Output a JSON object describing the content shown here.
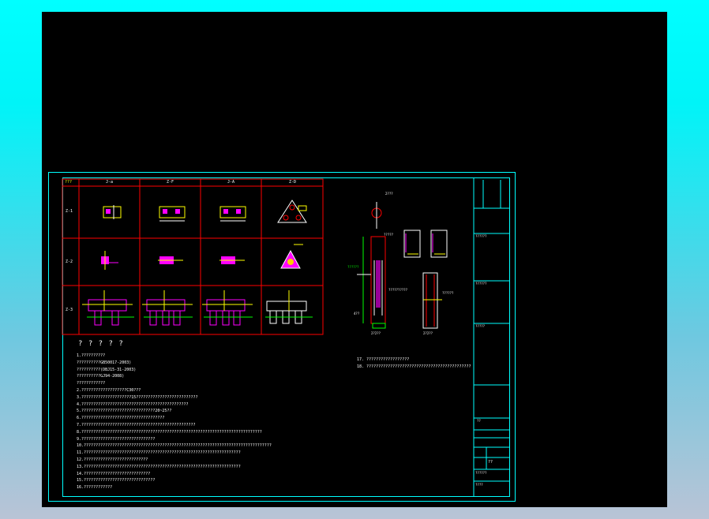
{
  "table": {
    "header_left": "???",
    "columns": [
      "J-a",
      "Z-F",
      "J-A",
      "Z-D"
    ],
    "rows": [
      "Z-1",
      "Z-2",
      "Z-3"
    ]
  },
  "notes": {
    "heading": "? ? ? ? ?",
    "lines": [
      "1.??????????",
      "??????????GB50017-2003)",
      "??????????(DBJ15-31-2003)",
      "??????????GJ94-2008)",
      "????????????",
      "2.???????????????????C30???",
      "3.?????????????????????15??????????????????????????",
      "4.?????????????????????????????????????????????",
      "5.???????????????????????????????20~25??",
      "6.???????????????????????????????????",
      "7.????????????????????????????????????????????????",
      "8.????????????????????????????????????????????????????????????????????????????",
      "9.???????????????????????????????",
      "10.???????????????????????????????????????????????????????????????????????????????",
      "11.??????????????????????????????????????????????????????????????????",
      "12.???????????????????????????",
      "13.??????????????????????????????????????????????????????????????????",
      "14.????????????????????????????",
      "15.??????????????????????????????",
      "16.????????????"
    ],
    "right_lines": [
      "17. ??????????????????",
      "18. ????????????????????????????????????????????"
    ]
  },
  "detail": {
    "label_a": "2???",
    "label_b": "?????",
    "label_c": "??????",
    "label_d": "??????????",
    "label_e": "4??",
    "label_f": "??????",
    "label_g": "2?2??",
    "label_h": "2?2??"
  },
  "title_block": {
    "a": "??????",
    "b": "??????",
    "c": "?????",
    "d": "??",
    "e": "??????",
    "f": "????",
    "g": "??"
  }
}
